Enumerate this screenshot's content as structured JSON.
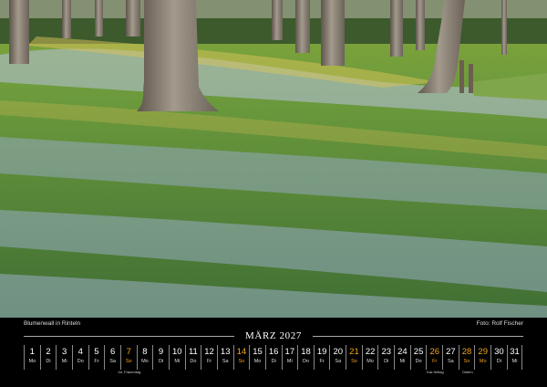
{
  "captions": {
    "title": "Blumenwall in Rinteln",
    "credit": "Foto: Rolf Fischer"
  },
  "month_title": "MÄRZ 2027",
  "accent_color": "#f2a51c",
  "days": [
    {
      "num": "1",
      "wd": "Mo",
      "hl": false,
      "note": ""
    },
    {
      "num": "2",
      "wd": "Di",
      "hl": false,
      "note": ""
    },
    {
      "num": "3",
      "wd": "Mi",
      "hl": false,
      "note": ""
    },
    {
      "num": "4",
      "wd": "Do",
      "hl": false,
      "note": ""
    },
    {
      "num": "5",
      "wd": "Fr",
      "hl": false,
      "note": ""
    },
    {
      "num": "6",
      "wd": "Sa",
      "hl": false,
      "note": ""
    },
    {
      "num": "7",
      "wd": "So",
      "hl": true,
      "note": "Int. Frauentag"
    },
    {
      "num": "8",
      "wd": "Mo",
      "hl": false,
      "note": ""
    },
    {
      "num": "9",
      "wd": "Di",
      "hl": false,
      "note": ""
    },
    {
      "num": "10",
      "wd": "Mi",
      "hl": false,
      "note": ""
    },
    {
      "num": "11",
      "wd": "Do",
      "hl": false,
      "note": ""
    },
    {
      "num": "12",
      "wd": "Fr",
      "hl": false,
      "note": ""
    },
    {
      "num": "13",
      "wd": "Sa",
      "hl": false,
      "note": ""
    },
    {
      "num": "14",
      "wd": "So",
      "hl": true,
      "note": ""
    },
    {
      "num": "15",
      "wd": "Mo",
      "hl": false,
      "note": ""
    },
    {
      "num": "16",
      "wd": "Di",
      "hl": false,
      "note": ""
    },
    {
      "num": "17",
      "wd": "Mi",
      "hl": false,
      "note": ""
    },
    {
      "num": "18",
      "wd": "Do",
      "hl": false,
      "note": ""
    },
    {
      "num": "19",
      "wd": "Fr",
      "hl": false,
      "note": ""
    },
    {
      "num": "20",
      "wd": "Sa",
      "hl": false,
      "note": ""
    },
    {
      "num": "21",
      "wd": "So",
      "hl": true,
      "note": ""
    },
    {
      "num": "22",
      "wd": "Mo",
      "hl": false,
      "note": ""
    },
    {
      "num": "23",
      "wd": "Di",
      "hl": false,
      "note": ""
    },
    {
      "num": "24",
      "wd": "Mi",
      "hl": false,
      "note": ""
    },
    {
      "num": "25",
      "wd": "Do",
      "hl": false,
      "note": ""
    },
    {
      "num": "26",
      "wd": "Fr",
      "hl": true,
      "note": "Kar-freitag"
    },
    {
      "num": "27",
      "wd": "Sa",
      "hl": false,
      "note": ""
    },
    {
      "num": "28",
      "wd": "So",
      "hl": true,
      "note": "Ostern"
    },
    {
      "num": "29",
      "wd": "Mo",
      "hl": true,
      "note": ""
    },
    {
      "num": "30",
      "wd": "Di",
      "hl": false,
      "note": ""
    },
    {
      "num": "31",
      "wd": "Mi",
      "hl": false,
      "note": ""
    }
  ]
}
